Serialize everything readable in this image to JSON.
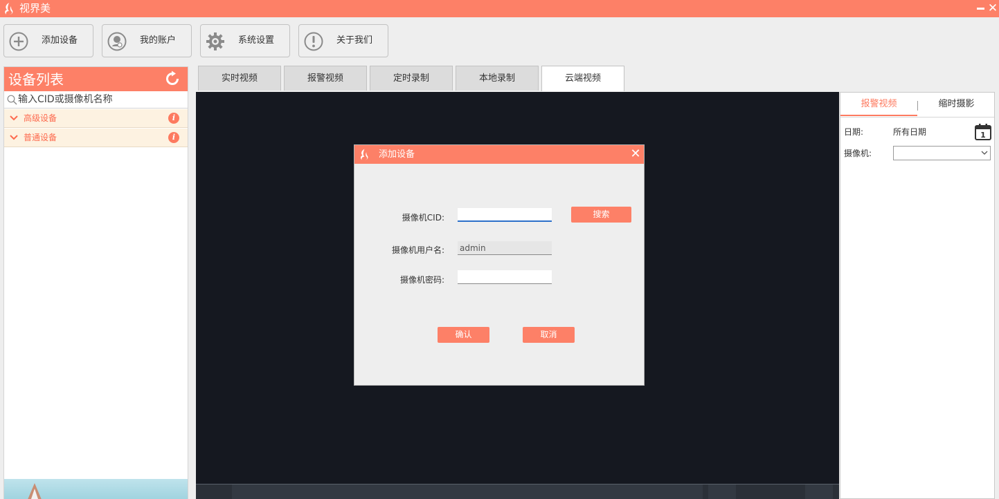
{
  "app": {
    "title": "视界美"
  },
  "toolbar": [
    {
      "label": "添加设备",
      "icon": "plus-circle-icon"
    },
    {
      "label": "我的账户",
      "icon": "account-icon"
    },
    {
      "label": "系统设置",
      "icon": "gear-icon"
    },
    {
      "label": "关于我们",
      "icon": "exclamation-circle-icon"
    }
  ],
  "device_panel": {
    "title": "设备列表",
    "search_placeholder": "输入CID或摄像机名称",
    "groups": [
      {
        "label": "高级设备"
      },
      {
        "label": "普通设备"
      }
    ]
  },
  "tabs": [
    {
      "label": "实时视频",
      "active": false
    },
    {
      "label": "报警视频",
      "active": false
    },
    {
      "label": "定时录制",
      "active": false
    },
    {
      "label": "本地录制",
      "active": false
    },
    {
      "label": "云端视频",
      "active": true
    }
  ],
  "right_panel": {
    "tabs": [
      {
        "label": "报警视频",
        "active": true
      },
      {
        "label": "缩时摄影",
        "active": false
      }
    ],
    "date_label": "日期:",
    "date_value": "所有日期",
    "calendar_day": "1",
    "camera_label": "摄像机:",
    "camera_value": ""
  },
  "dialog": {
    "title": "添加设备",
    "cid_label": "摄像机CID:",
    "cid_value": "",
    "search_label": "搜索",
    "username_label": "摄像机用户名:",
    "username_value": "admin",
    "password_label": "摄像机密码:",
    "password_value": "",
    "confirm_label": "确认",
    "cancel_label": "取消"
  },
  "colors": {
    "accent": "#fd8067",
    "video_bg": "#151820",
    "group_bg": "#fdf2e1"
  }
}
